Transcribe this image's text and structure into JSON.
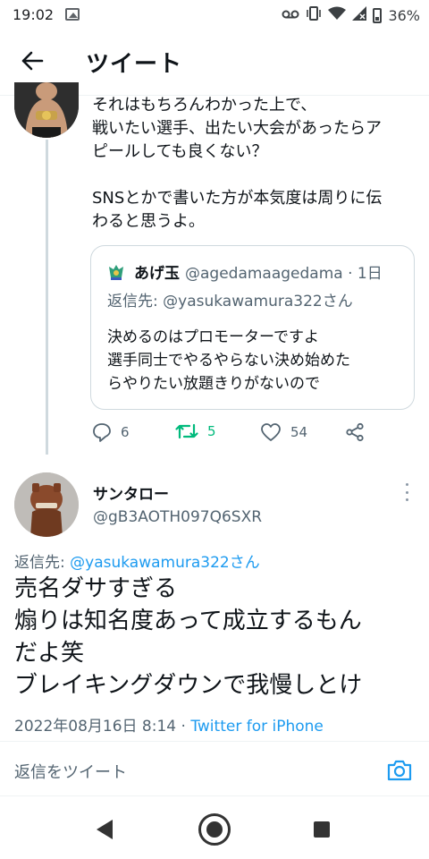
{
  "status_bar": {
    "time": "19:02",
    "battery": "36%",
    "icons": [
      "image-icon",
      "voicemail-icon",
      "vibrate-icon",
      "wifi-icon",
      "signal-icon",
      "battery-icon"
    ]
  },
  "header": {
    "title": "ツイート",
    "back_icon": "arrow-left-icon"
  },
  "tweet1": {
    "text": "それはもちろんわかった上で、\n戦いたい選手、出たい大会があったらア\nピールしても良くない？\n\nSNSとかで書いた方が本気度は周りに伝\nわると思うよ。",
    "quote": {
      "name": "あげ玉",
      "handle": "@agedamaagedama · 1日",
      "reply_to": "返信先: @yasukawamura322さん",
      "text": "決めるのはプロモーターですよ\n選手同士でやるやらない決め始めた\nらやりたい放題きりがないので"
    },
    "actions": {
      "replies": "6",
      "retweets": "5",
      "likes": "54"
    }
  },
  "tweet2": {
    "name": "サンタロー",
    "handle": "@gB3AOTH097Q6SXR",
    "reply_prefix": "返信先: ",
    "reply_mention": "@yasukawamura322さん",
    "text": "売名ダサすぎる\n煽りは知名度あって成立するもん\nだよ笑\nブレイキングダウンで我慢しとけ",
    "timestamp": "2022年08月16日 8:14 · ",
    "source": "Twitter for iPhone"
  },
  "reply_bar": {
    "placeholder": "返信をツイート"
  },
  "colors": {
    "accent": "#1d9bf0",
    "retweet": "#00ba7c",
    "secondary_text": "#536471"
  }
}
